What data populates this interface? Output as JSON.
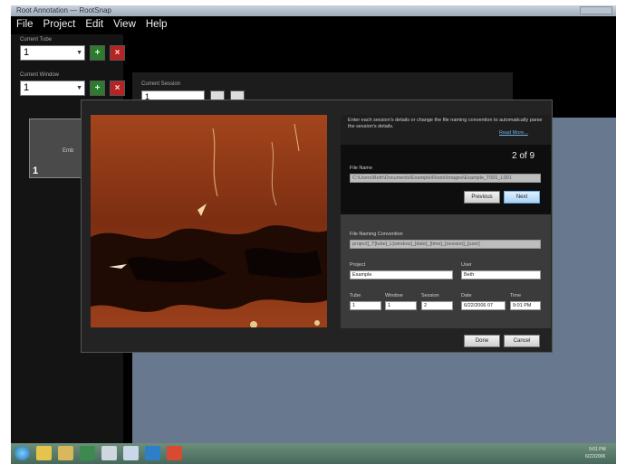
{
  "window": {
    "title": "Root Annotation — RootSnap"
  },
  "menu": [
    "File",
    "Project",
    "Edit",
    "View",
    "Help"
  ],
  "left": {
    "current_tube_label": "Current Tube",
    "current_tube_value": "1",
    "current_window_label": "Current Window",
    "current_window_value": "1",
    "add_symbol": "+",
    "remove_symbol": "×",
    "thumb_number": "1",
    "thumb_text": "Emb"
  },
  "session": {
    "label": "Current Session",
    "value": "1"
  },
  "dialog": {
    "instructions": "Enter each session's details or change the file naming convention to automatically parse the session's details.",
    "read_more": "Read More...",
    "counter": "2 of 9",
    "file_name_label": "File Name",
    "file_name_value": "C:\\Users\\Beth\\Documents\\Example\\Roots\\Images\\Example_T001_L001",
    "previous_label": "Previous",
    "next_label": "Next",
    "convention_label": "File Naming Convention",
    "convention_value": "project]_T[tube]_L[window]_[date]_[time]_[session]_[user]",
    "project_label": "Project",
    "project_value": "Example",
    "user_label": "User",
    "user_value": "Beth",
    "tube_label": "Tube",
    "tube_value": "1",
    "window_label": "Window",
    "window_value": "1",
    "session_label": "Session",
    "session_value": "2",
    "date_label": "Date",
    "date_value": "6/22/2006 07",
    "time_label": "Time",
    "time_value": "9:01 PM",
    "done_label": "Done",
    "cancel_label": "Cancel"
  },
  "taskbar": {
    "clock": "9:01 PM",
    "date": "6/22/2006"
  }
}
